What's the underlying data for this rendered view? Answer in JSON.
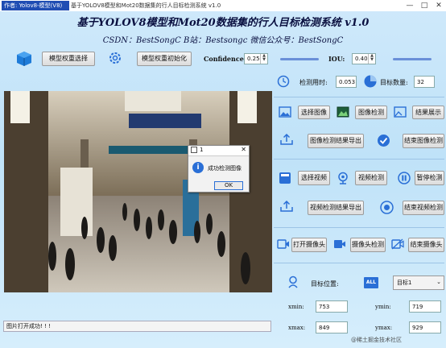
{
  "window": {
    "badge": "作者: Yolov8-模型(V8)",
    "title": "基于YOLOV8模型和Mot20数据集的行人目标检测系统 v1.0",
    "minimize": "—",
    "maximize": "□",
    "close": "✕"
  },
  "header": {
    "title": "基于YOLOV8模型和Mot20数据集的行人目标检测系统 v1.0",
    "subtitle": "CSDN：BestSongC   B站：Bestsongc   微信公众号：BestSongC"
  },
  "toolbar": {
    "select_weights": "模型权重选择",
    "init_weights": "模型权重初始化",
    "confidence_label": "Confidence:",
    "confidence_value": "0.25",
    "confidence_level": 0.25,
    "iou_label": "IOU:",
    "iou_value": "0.40",
    "iou_level": 0.4
  },
  "stats": {
    "time_label": "检测用时:",
    "time_value": "0.053",
    "count_label": "目标数量:",
    "count_value": "32"
  },
  "image_section": {
    "select_image": "选择图像",
    "image_detect": "图像检测",
    "show_result": "结果展示",
    "export_image": "图像检测结果导出",
    "end_image": "结束图像检测"
  },
  "video_section": {
    "select_video": "选择视频",
    "video_detect": "视频检测",
    "pause_detect": "暂停检测",
    "export_video": "视频检测结果导出",
    "end_video": "结束视频检测"
  },
  "camera_section": {
    "open_camera": "打开摄像头",
    "camera_detect": "摄像头检测",
    "end_camera": "结束摄像头"
  },
  "target": {
    "position_label": "目标位置:",
    "all_badge": "ALL",
    "selected": "目标1",
    "xmin_label": "xmin:",
    "xmin_value": "753",
    "ymin_label": "ymin:",
    "ymin_value": "719",
    "xmax_label": "xmax:",
    "xmax_value": "849",
    "ymax_label": "ymax:",
    "ymax_value": "929"
  },
  "dialog": {
    "title": "1",
    "message": "成功检测图像",
    "ok": "OK"
  },
  "status_bar": {
    "text": "图片打开成功! ! !"
  },
  "watermark": "@稀土掘金技术社区",
  "colors": {
    "accent": "#2a6fd6",
    "background": "#cfe9fb",
    "title_text": "#0a1040"
  }
}
